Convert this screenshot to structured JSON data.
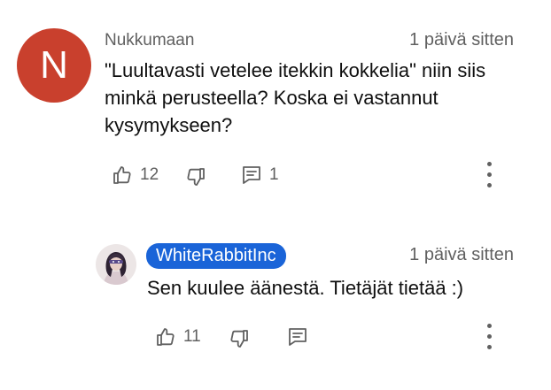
{
  "colors": {
    "avatar_bg": "#c9402d",
    "badge_bg": "#1a64d8",
    "secondary_text": "#606060",
    "primary_text": "#0f0f0f"
  },
  "comments": [
    {
      "avatar_letter": "N",
      "author": "Nukkumaan",
      "timestamp": "1 päivä sitten",
      "text": "\"Luultavasti vetelee itekkin kokkelia\" niin siis minkä perusteella? Koska ei vastannut kysymykseen?",
      "likes": "12",
      "replies": "1",
      "icons": [
        "thumb-up-icon",
        "thumb-down-icon",
        "reply-icon",
        "more-vert-icon"
      ]
    },
    {
      "author": "WhiteRabbitInc",
      "timestamp": "1 päivä sitten",
      "text": "Sen kuulee äänestä. Tietäjät tietää :)",
      "likes": "11",
      "icons": [
        "thumb-up-icon",
        "thumb-down-icon",
        "reply-icon",
        "more-vert-icon"
      ]
    }
  ]
}
